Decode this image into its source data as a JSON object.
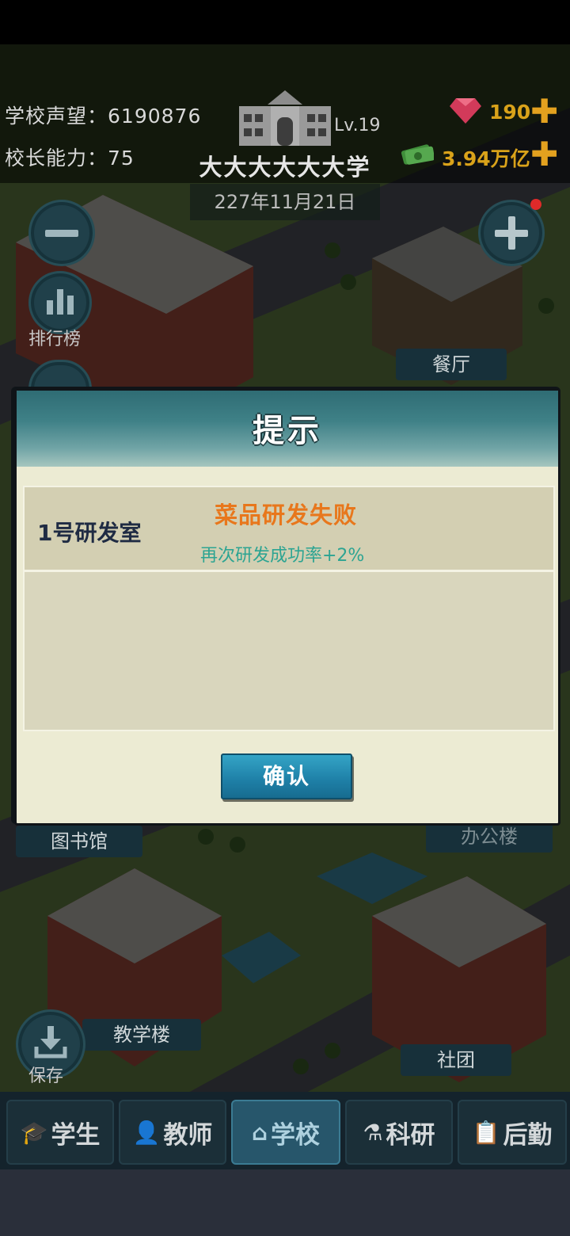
{
  "hud": {
    "reputation_label": "学校声望：",
    "reputation_value": "6190876",
    "principal_label": "校长能力：",
    "principal_value": "75",
    "school_level": "Lv.19",
    "school_name": "大大大大大大学",
    "date": "227年11月21日",
    "gems": "190",
    "money": "3.94万亿"
  },
  "side": {
    "ranking_label": "排行榜",
    "save_label": "保存"
  },
  "buildings": {
    "canteen": "餐厅",
    "library": "图书馆",
    "teaching": "教学楼",
    "club": "社团",
    "office": "办公楼"
  },
  "dialog": {
    "title": "提示",
    "room": "1号研发室",
    "result": "菜品研发失败",
    "bonus": "再次研发成功率+2%",
    "confirm": "确认"
  },
  "nav": {
    "tabs": [
      {
        "label": "学生",
        "icon": "student-icon"
      },
      {
        "label": "教师",
        "icon": "teacher-icon"
      },
      {
        "label": "学校",
        "icon": "school-icon"
      },
      {
        "label": "科研",
        "icon": "research-icon"
      },
      {
        "label": "后勤",
        "icon": "logistics-icon"
      }
    ],
    "active": "学校"
  },
  "colors": {
    "accent_orange": "#e8771c",
    "accent_teal": "#2ca492",
    "gold": "#d9a21a",
    "nav_active": "#27566b"
  }
}
